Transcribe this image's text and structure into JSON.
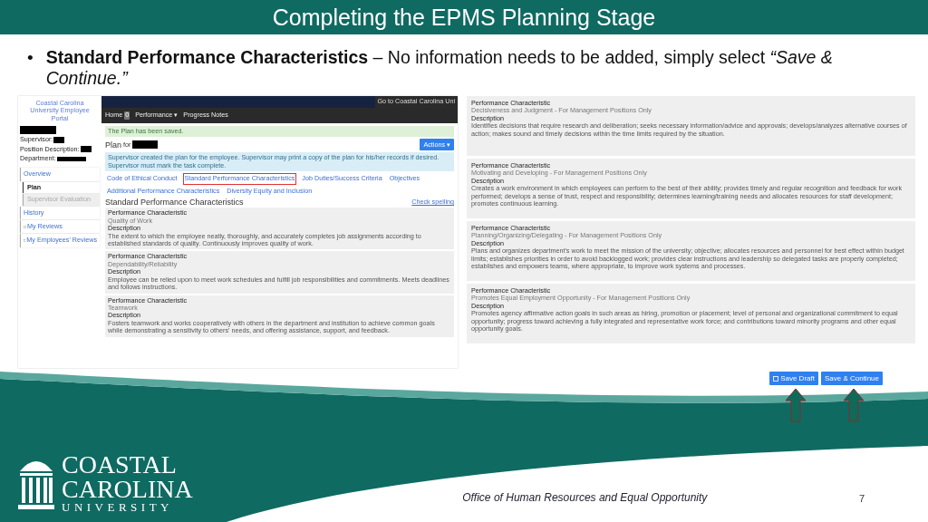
{
  "title": "Completing the EPMS Planning Stage",
  "bullet_mark": "•",
  "bullet": "**Standard Performance Characteristics** – No information needs to be added, simply select *“Save & Continue.”*",
  "portal": {
    "logo_text": "Coastal Carolina University Employee Portal",
    "top_link": "Go to Coastal Carolina Uni",
    "nav": [
      {
        "label": "Home",
        "badge": "0"
      },
      {
        "label": "Performance ▾"
      },
      {
        "label": "Progress Notes"
      }
    ],
    "fields": [
      {
        "label": "Supervisor:"
      },
      {
        "label": "Position Description:"
      },
      {
        "label": "Department:"
      }
    ],
    "menu": [
      {
        "label": "Overview",
        "kind": "section",
        "selected": false,
        "disabled": false
      },
      {
        "label": "Plan",
        "kind": "sub",
        "selected": true,
        "disabled": false
      },
      {
        "label": "Supervisor Evaluation",
        "kind": "sub",
        "selected": false,
        "disabled": true
      },
      {
        "label": "History",
        "kind": "section",
        "selected": false,
        "disabled": false
      },
      {
        "label": "My Reviews",
        "kind": "link",
        "selected": false,
        "disabled": false
      },
      {
        "label": "My Employees' Reviews",
        "kind": "link",
        "selected": false,
        "disabled": false
      }
    ],
    "alert": "The Plan has been saved.",
    "plan_title": "Plan",
    "plan_for": "for",
    "actions": "Actions ▾",
    "info": "Supervisor created the plan for the employee. Supervisor may print a copy of the plan for his/her records if desired. Supervisor must mark the task complete.",
    "tabs": [
      {
        "label": "Code of Ethical Conduct",
        "selected": false
      },
      {
        "label": "Standard Performance Characteristics",
        "selected": true
      },
      {
        "label": "Job Duties/Success Criteria",
        "selected": false
      },
      {
        "label": "Objectives",
        "selected": false
      },
      {
        "label": "Additional Performance Characteristics",
        "selected": false
      },
      {
        "label": "Diversity Equity and Inclusion",
        "selected": false
      }
    ],
    "heading": "Standard Performance Characteristics",
    "check_spelling": "Check spelling",
    "cards": [
      {
        "label": "Performance Characteristic",
        "name": "Quality of Work",
        "desc_label": "Description",
        "description": "The extent to which the employee neatly, thoroughly, and accurately completes job assignments according to established standards of quality. Continuously improves quality of work."
      },
      {
        "label": "Performance Characteristic",
        "name": "Dependability/Reliability",
        "desc_label": "Description",
        "description": "Employee can be relied upon to meet work schedules and fulfill job responsibilities and commitments. Meets deadlines and follows instructions."
      },
      {
        "label": "Performance Characteristic",
        "name": "Teamwork",
        "desc_label": "Description",
        "description": "Fosters teamwork and works cooperatively with others in the department and institution to achieve common goals while demonstrating a sensitivity to others' needs, and offering assistance, support, and feedback."
      }
    ]
  },
  "right_cards": [
    {
      "label": "Performance Characteristic",
      "name": "Decisiveness and Judgment - For Management Positions Only",
      "desc_label": "Description",
      "description": "Identifies decisions that require research and deliberation; seeks necessary information/advice and approvals; develops/analyzes alternative courses of action; makes sound and timely decisions within the time limits required by the situation."
    },
    {
      "label": "Performance Characteristic",
      "name": "Motivating and Developing - For Management Positions Only",
      "desc_label": "Description",
      "description": "Creates a work environment in which employees can perform to the best of their ability; provides timely and regular recognition and feedback for work performed; develops a sense of trust, respect and responsibility; determines learning/training needs and allocates resources for staff development; promotes continuous learning."
    },
    {
      "label": "Performance Characteristic",
      "name": "Planning/Organizing/Delegating - For Management Positions Only",
      "desc_label": "Description",
      "description": "Plans and organizes department's work to meet the mission of the university; objective; allocates resources and personnel for best effect within budget limits; establishes priorities in order to avoid backlogged work; provides clear instructions and leadership so delegated tasks are properly completed; establishes and empowers teams, where appropriate, to improve work systems and processes."
    },
    {
      "label": "Performance Characteristic",
      "name": "Promotes Equal Employment Opportunity - For Management Positions Only",
      "desc_label": "Description",
      "description": "Promotes agency affirmative action goals in such areas as hiring, promotion or placement; level of personal and organizational commitment to equal opportunity; progress toward achieving a fully integrated and representative work force; and contributions toward minority programs and other equal opportunity goals."
    }
  ],
  "buttons": [
    {
      "label": "Save Draft",
      "kind": "icon"
    },
    {
      "label": "Save & Continue",
      "kind": "plain"
    }
  ],
  "logo": {
    "line_1": "COASTAL",
    "line_2": "CAROLINA",
    "line_3": "UNIVERSITY"
  },
  "footer": "Office of Human Resources and Equal Opportunity",
  "page": "7"
}
